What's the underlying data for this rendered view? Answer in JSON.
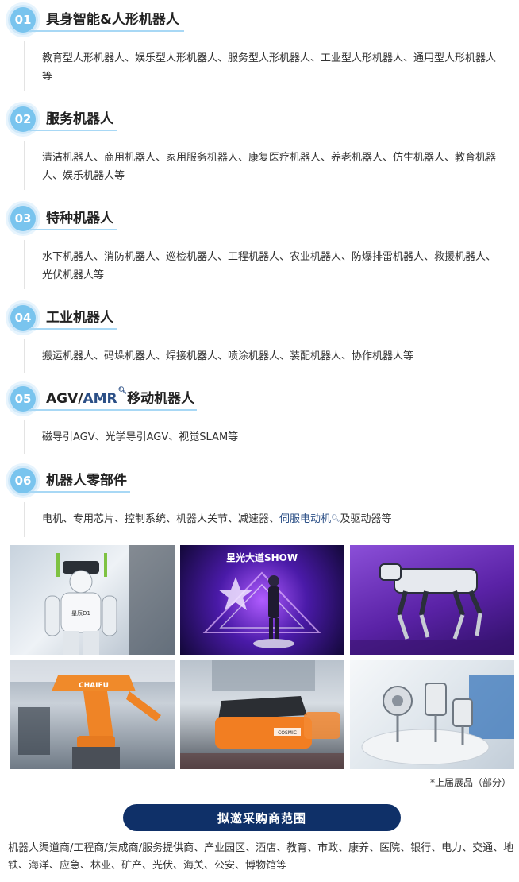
{
  "sections": [
    {
      "number": "01",
      "title": "具身智能&人形机器人",
      "text": "教育型人形机器人、娱乐型人形机器人、服务型人形机器人、工业型人形机器人、通用型人形机器人等"
    },
    {
      "number": "02",
      "title": "服务机器人",
      "text": "清洁机器人、商用机器人、家用服务机器人、康复医疗机器人、养老机器人、仿生机器人、教育机器人、娱乐机器人等"
    },
    {
      "number": "03",
      "title": "特种机器人",
      "text": "水下机器人、消防机器人、巡检机器人、工程机器人、农业机器人、防爆排雷机器人、救援机器人、光伏机器人等"
    },
    {
      "number": "04",
      "title": "工业机器人",
      "text": "搬运机器人、码垛机器人、焊接机器人、喷涂机器人、装配机器人、协作机器人等"
    },
    {
      "number": "05",
      "title_prefix": "AGV/",
      "title_link": "AMR",
      "title_suffix": "移动机器人",
      "text": "磁导引AGV、光学导引AGV、视觉SLAM等"
    },
    {
      "number": "06",
      "title": "机器人零部件",
      "text_prefix": "电机、专用芯片、控制系统、机器人关节、减速器、",
      "text_link": "伺服电动机",
      "text_suffix": "及驱动器等"
    }
  ],
  "photos": [
    {
      "sign_text": "星辰D1"
    },
    {
      "sign_text": "星光大道SHOW"
    },
    {},
    {
      "sign_text": "CHAIFU"
    },
    {
      "sign_text": "COSMIC"
    },
    {}
  ],
  "caption": "*上届展品（部分）",
  "banner": "拟邀采购商范围",
  "buyers": "机器人渠道商/工程商/集成商/服务提供商、产业园区、酒店、教育、市政、康养、医院、银行、电力、交通、地铁、海洋、应急、林业、矿产、光伏、海关、公安、博物馆等",
  "colors": {
    "badge": "#79c4ee",
    "badge_ring": "#cfe8f9",
    "underline": "#a8d8f5",
    "link": "#2b4f86",
    "banner": "#0f3068"
  },
  "icons": {
    "link_marker": "search-icon"
  }
}
